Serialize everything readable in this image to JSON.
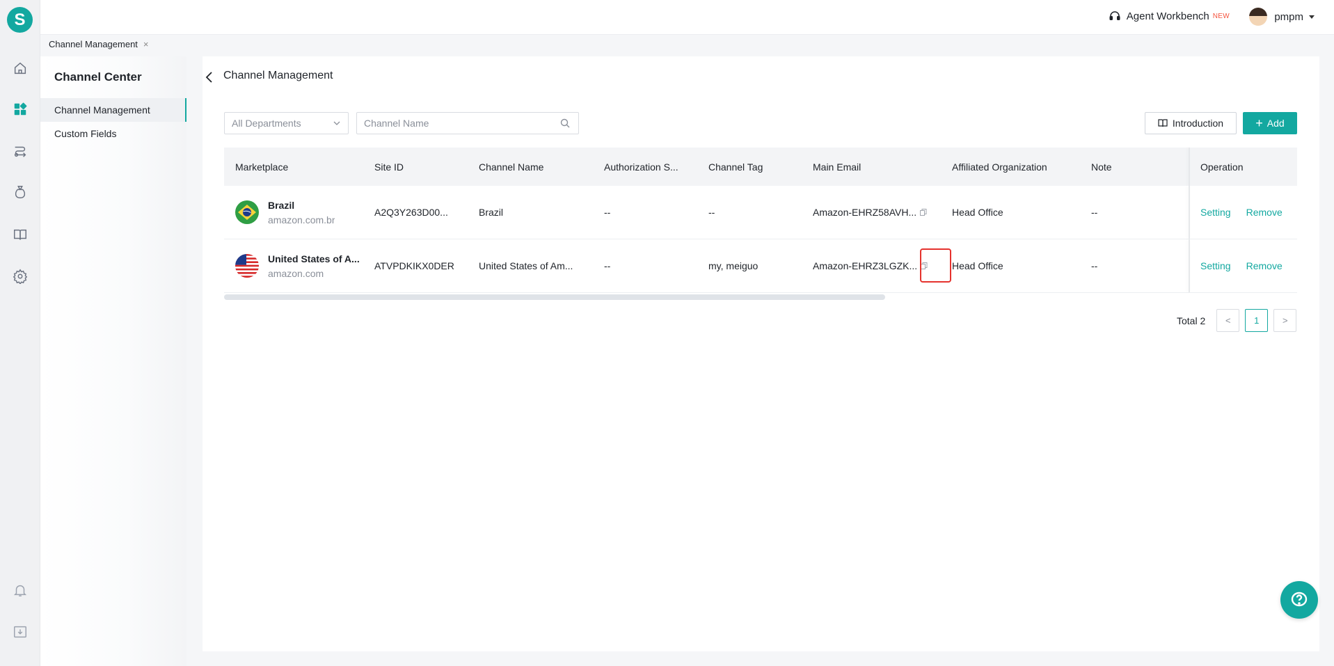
{
  "rail": {
    "logo_letter": "S",
    "icons": [
      "home-icon",
      "dashboard-icon",
      "route-icon",
      "money-bag-icon",
      "book-icon",
      "gear-icon",
      "bell-icon",
      "download-icon"
    ]
  },
  "header": {
    "workbench_label": "Agent Workbench",
    "new_badge": "NEW",
    "username": "pmpm"
  },
  "tabs": [
    {
      "label": "Channel Management",
      "close": "×"
    }
  ],
  "sidebar": {
    "title": "Channel Center",
    "items": [
      {
        "label": "Channel Management",
        "active": true
      },
      {
        "label": "Custom Fields",
        "active": false
      }
    ]
  },
  "page": {
    "title": "Channel Management"
  },
  "filters": {
    "department_selected": "All Departments",
    "channel_name_placeholder": "Channel Name",
    "channel_name_value": ""
  },
  "actions": {
    "introduction_label": "Introduction",
    "add_label": "Add"
  },
  "table": {
    "columns": [
      "Marketplace",
      "Site ID",
      "Channel Name",
      "Authorization S...",
      "Channel Tag",
      "Main Email",
      "Affiliated Organization",
      "Note",
      "Operation"
    ],
    "rows": [
      {
        "marketplace_name": "Brazil",
        "marketplace_domain": "amazon.com.br",
        "flag": "brazil-flag-icon",
        "site_id": "A2Q3Y263D00...",
        "channel_name": "Brazil",
        "authorization_status": "--",
        "channel_tag": "--",
        "main_email": "Amazon-EHRZ58AVH...",
        "affiliated_org": "Head Office",
        "note": "--",
        "op_setting": "Setting",
        "op_remove": "Remove"
      },
      {
        "marketplace_name": "United States of A...",
        "marketplace_domain": "amazon.com",
        "flag": "usa-flag-icon",
        "site_id": "ATVPDKIKX0DER",
        "channel_name": "United States of Am...",
        "authorization_status": "--",
        "channel_tag": "my, meiguo",
        "main_email": "Amazon-EHRZ3LGZK...",
        "affiliated_org": "Head Office",
        "note": "--",
        "op_setting": "Setting",
        "op_remove": "Remove"
      }
    ]
  },
  "pagination": {
    "total_label": "Total 2",
    "current_page": "1",
    "prev": "<",
    "next": ">"
  },
  "colors": {
    "accent": "#13a8a0",
    "highlight": "#e5322d"
  }
}
